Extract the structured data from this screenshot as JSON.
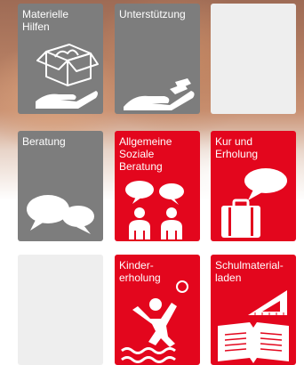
{
  "tiles": [
    {
      "label": "Materielle\nHilfen",
      "icon": "box-in-hand-icon"
    },
    {
      "label": "Unterstützung",
      "icon": "open-hand-icon"
    },
    {
      "label": "",
      "icon": ""
    },
    {
      "label": "Beratung",
      "icon": "speech-bubbles-icon"
    },
    {
      "label": "Allgemeine\nSoziale\nBeratung",
      "icon": "two-people-talking-icon"
    },
    {
      "label": "Kur und\nErholung",
      "icon": "suitcase-speech-icon"
    },
    {
      "label": "",
      "icon": ""
    },
    {
      "label": "Kinder-\nerholung",
      "icon": "child-swimming-ball-icon"
    },
    {
      "label": "Schulmaterial-\nladen",
      "icon": "book-ruler-icon"
    }
  ],
  "colors": {
    "grey": "#7d7d7d",
    "red": "#e3061d",
    "light": "#eeeeee"
  }
}
